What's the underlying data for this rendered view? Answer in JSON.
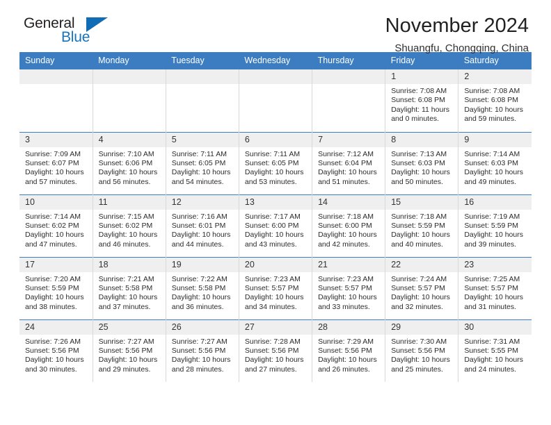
{
  "brand": {
    "name_part1": "General",
    "name_part2": "Blue",
    "triangle_color": "#0f6cb5",
    "blue_text_color": "#1673bd"
  },
  "header": {
    "title": "November 2024",
    "subtitle": "Shuangfu, Chongqing, China",
    "header_bg_color": "#3b7dc0",
    "daynum_bg_color": "#efefef"
  },
  "weekday_headers": [
    "Sunday",
    "Monday",
    "Tuesday",
    "Wednesday",
    "Thursday",
    "Friday",
    "Saturday"
  ],
  "labels": {
    "sunrise_prefix": "Sunrise:",
    "sunset_prefix": "Sunset:",
    "daylight_prefix": "Daylight:"
  },
  "weeks": [
    [
      {
        "day": "",
        "empty": true
      },
      {
        "day": "",
        "empty": true
      },
      {
        "day": "",
        "empty": true
      },
      {
        "day": "",
        "empty": true
      },
      {
        "day": "",
        "empty": true
      },
      {
        "day": "1",
        "sunrise": "Sunrise: 7:08 AM",
        "sunset": "Sunset: 6:08 PM",
        "daylight_line1": "Daylight: 11 hours",
        "daylight_line2": "and 0 minutes."
      },
      {
        "day": "2",
        "sunrise": "Sunrise: 7:08 AM",
        "sunset": "Sunset: 6:08 PM",
        "daylight_line1": "Daylight: 10 hours",
        "daylight_line2": "and 59 minutes."
      }
    ],
    [
      {
        "day": "3",
        "sunrise": "Sunrise: 7:09 AM",
        "sunset": "Sunset: 6:07 PM",
        "daylight_line1": "Daylight: 10 hours",
        "daylight_line2": "and 57 minutes."
      },
      {
        "day": "4",
        "sunrise": "Sunrise: 7:10 AM",
        "sunset": "Sunset: 6:06 PM",
        "daylight_line1": "Daylight: 10 hours",
        "daylight_line2": "and 56 minutes."
      },
      {
        "day": "5",
        "sunrise": "Sunrise: 7:11 AM",
        "sunset": "Sunset: 6:05 PM",
        "daylight_line1": "Daylight: 10 hours",
        "daylight_line2": "and 54 minutes."
      },
      {
        "day": "6",
        "sunrise": "Sunrise: 7:11 AM",
        "sunset": "Sunset: 6:05 PM",
        "daylight_line1": "Daylight: 10 hours",
        "daylight_line2": "and 53 minutes."
      },
      {
        "day": "7",
        "sunrise": "Sunrise: 7:12 AM",
        "sunset": "Sunset: 6:04 PM",
        "daylight_line1": "Daylight: 10 hours",
        "daylight_line2": "and 51 minutes."
      },
      {
        "day": "8",
        "sunrise": "Sunrise: 7:13 AM",
        "sunset": "Sunset: 6:03 PM",
        "daylight_line1": "Daylight: 10 hours",
        "daylight_line2": "and 50 minutes."
      },
      {
        "day": "9",
        "sunrise": "Sunrise: 7:14 AM",
        "sunset": "Sunset: 6:03 PM",
        "daylight_line1": "Daylight: 10 hours",
        "daylight_line2": "and 49 minutes."
      }
    ],
    [
      {
        "day": "10",
        "sunrise": "Sunrise: 7:14 AM",
        "sunset": "Sunset: 6:02 PM",
        "daylight_line1": "Daylight: 10 hours",
        "daylight_line2": "and 47 minutes."
      },
      {
        "day": "11",
        "sunrise": "Sunrise: 7:15 AM",
        "sunset": "Sunset: 6:02 PM",
        "daylight_line1": "Daylight: 10 hours",
        "daylight_line2": "and 46 minutes."
      },
      {
        "day": "12",
        "sunrise": "Sunrise: 7:16 AM",
        "sunset": "Sunset: 6:01 PM",
        "daylight_line1": "Daylight: 10 hours",
        "daylight_line2": "and 44 minutes."
      },
      {
        "day": "13",
        "sunrise": "Sunrise: 7:17 AM",
        "sunset": "Sunset: 6:00 PM",
        "daylight_line1": "Daylight: 10 hours",
        "daylight_line2": "and 43 minutes."
      },
      {
        "day": "14",
        "sunrise": "Sunrise: 7:18 AM",
        "sunset": "Sunset: 6:00 PM",
        "daylight_line1": "Daylight: 10 hours",
        "daylight_line2": "and 42 minutes."
      },
      {
        "day": "15",
        "sunrise": "Sunrise: 7:18 AM",
        "sunset": "Sunset: 5:59 PM",
        "daylight_line1": "Daylight: 10 hours",
        "daylight_line2": "and 40 minutes."
      },
      {
        "day": "16",
        "sunrise": "Sunrise: 7:19 AM",
        "sunset": "Sunset: 5:59 PM",
        "daylight_line1": "Daylight: 10 hours",
        "daylight_line2": "and 39 minutes."
      }
    ],
    [
      {
        "day": "17",
        "sunrise": "Sunrise: 7:20 AM",
        "sunset": "Sunset: 5:59 PM",
        "daylight_line1": "Daylight: 10 hours",
        "daylight_line2": "and 38 minutes."
      },
      {
        "day": "18",
        "sunrise": "Sunrise: 7:21 AM",
        "sunset": "Sunset: 5:58 PM",
        "daylight_line1": "Daylight: 10 hours",
        "daylight_line2": "and 37 minutes."
      },
      {
        "day": "19",
        "sunrise": "Sunrise: 7:22 AM",
        "sunset": "Sunset: 5:58 PM",
        "daylight_line1": "Daylight: 10 hours",
        "daylight_line2": "and 36 minutes."
      },
      {
        "day": "20",
        "sunrise": "Sunrise: 7:23 AM",
        "sunset": "Sunset: 5:57 PM",
        "daylight_line1": "Daylight: 10 hours",
        "daylight_line2": "and 34 minutes."
      },
      {
        "day": "21",
        "sunrise": "Sunrise: 7:23 AM",
        "sunset": "Sunset: 5:57 PM",
        "daylight_line1": "Daylight: 10 hours",
        "daylight_line2": "and 33 minutes."
      },
      {
        "day": "22",
        "sunrise": "Sunrise: 7:24 AM",
        "sunset": "Sunset: 5:57 PM",
        "daylight_line1": "Daylight: 10 hours",
        "daylight_line2": "and 32 minutes."
      },
      {
        "day": "23",
        "sunrise": "Sunrise: 7:25 AM",
        "sunset": "Sunset: 5:57 PM",
        "daylight_line1": "Daylight: 10 hours",
        "daylight_line2": "and 31 minutes."
      }
    ],
    [
      {
        "day": "24",
        "sunrise": "Sunrise: 7:26 AM",
        "sunset": "Sunset: 5:56 PM",
        "daylight_line1": "Daylight: 10 hours",
        "daylight_line2": "and 30 minutes."
      },
      {
        "day": "25",
        "sunrise": "Sunrise: 7:27 AM",
        "sunset": "Sunset: 5:56 PM",
        "daylight_line1": "Daylight: 10 hours",
        "daylight_line2": "and 29 minutes."
      },
      {
        "day": "26",
        "sunrise": "Sunrise: 7:27 AM",
        "sunset": "Sunset: 5:56 PM",
        "daylight_line1": "Daylight: 10 hours",
        "daylight_line2": "and 28 minutes."
      },
      {
        "day": "27",
        "sunrise": "Sunrise: 7:28 AM",
        "sunset": "Sunset: 5:56 PM",
        "daylight_line1": "Daylight: 10 hours",
        "daylight_line2": "and 27 minutes."
      },
      {
        "day": "28",
        "sunrise": "Sunrise: 7:29 AM",
        "sunset": "Sunset: 5:56 PM",
        "daylight_line1": "Daylight: 10 hours",
        "daylight_line2": "and 26 minutes."
      },
      {
        "day": "29",
        "sunrise": "Sunrise: 7:30 AM",
        "sunset": "Sunset: 5:56 PM",
        "daylight_line1": "Daylight: 10 hours",
        "daylight_line2": "and 25 minutes."
      },
      {
        "day": "30",
        "sunrise": "Sunrise: 7:31 AM",
        "sunset": "Sunset: 5:55 PM",
        "daylight_line1": "Daylight: 10 hours",
        "daylight_line2": "and 24 minutes."
      }
    ]
  ]
}
